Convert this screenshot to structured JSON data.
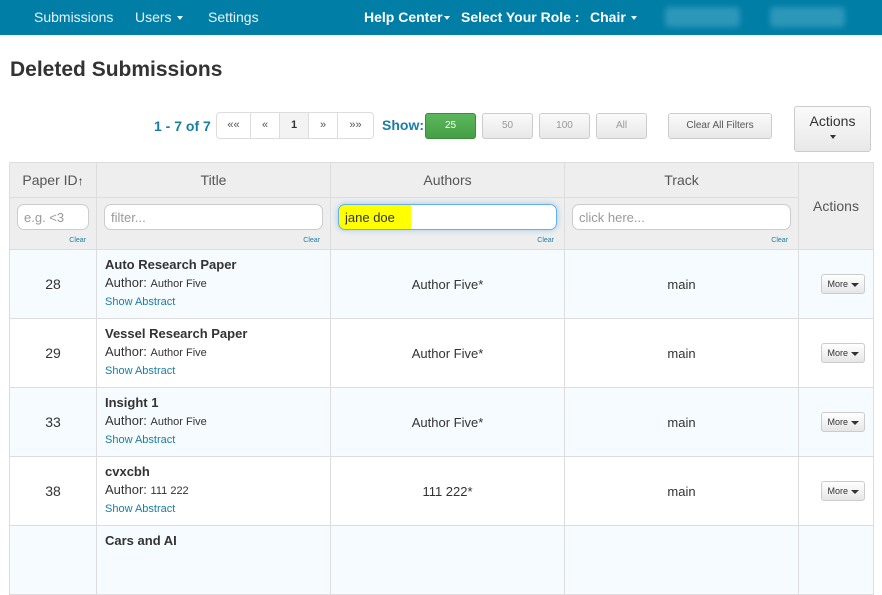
{
  "navbar": {
    "items": [
      {
        "label": "Submissions",
        "dropdown": false
      },
      {
        "label": "Users",
        "dropdown": true
      },
      {
        "label": "Settings",
        "dropdown": false
      }
    ],
    "help_center": "Help Center",
    "role_label": "Select Your Role :",
    "role_value": "Chair"
  },
  "page": {
    "title": "Deleted Submissions"
  },
  "toolbar": {
    "count": "1 - 7 of 7",
    "pager": [
      "««",
      "«",
      "1",
      "»",
      "»»"
    ],
    "show_label": "Show:",
    "page_sizes": [
      "25",
      "50",
      "100",
      "All"
    ],
    "active_page_size": "25",
    "clear_filters": "Clear All Filters",
    "actions": "Actions"
  },
  "table": {
    "columns": [
      "Paper ID",
      "Title",
      "Authors",
      "Track",
      "Actions"
    ],
    "sort_indicator": "↑",
    "filters": {
      "paper_id_placeholder": "e.g. <3",
      "title_placeholder": "filter...",
      "authors_value": "jane doe",
      "track_placeholder": "click here...",
      "clear_label": "Clear"
    },
    "author_prefix": "Author:",
    "show_abstract": "Show Abstract",
    "more_label": "More",
    "rows": [
      {
        "id": "28",
        "title": "Auto Research Paper",
        "author": "Author Five",
        "authors": "Author Five*",
        "track": "main"
      },
      {
        "id": "29",
        "title": "Vessel Research Paper",
        "author": "Author Five",
        "authors": "Author Five*",
        "track": "main"
      },
      {
        "id": "33",
        "title": "Insight 1",
        "author": "Author Five",
        "authors": "Author Five*",
        "track": "main"
      },
      {
        "id": "38",
        "title": "cvxcbh",
        "author": "111 222",
        "authors": "111 222*",
        "track": "main"
      },
      {
        "id": "",
        "title": "Cars and AI",
        "author": "",
        "authors": "",
        "track": ""
      }
    ]
  }
}
